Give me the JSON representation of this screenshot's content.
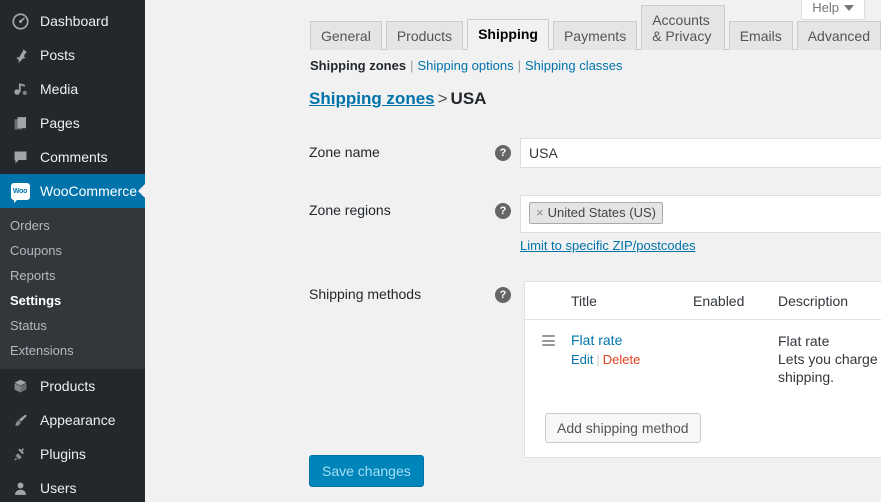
{
  "sidebar": {
    "items": [
      {
        "label": "Dashboard",
        "icon": "dashboard-icon",
        "name": "dashboard"
      },
      {
        "label": "Posts",
        "icon": "pushpin-icon",
        "name": "posts"
      },
      {
        "label": "Media",
        "icon": "media-icon",
        "name": "media"
      },
      {
        "label": "Pages",
        "icon": "pages-icon",
        "name": "pages"
      },
      {
        "label": "Comments",
        "icon": "comment-icon",
        "name": "comments"
      },
      {
        "label": "WooCommerce",
        "icon": "woocommerce-icon",
        "name": "woocommerce",
        "current": true
      },
      {
        "label": "Products",
        "icon": "box-icon",
        "name": "products"
      },
      {
        "label": "Appearance",
        "icon": "paintbrush-icon",
        "name": "appearance"
      },
      {
        "label": "Plugins",
        "icon": "plug-icon",
        "name": "plugins"
      },
      {
        "label": "Users",
        "icon": "user-icon",
        "name": "users"
      }
    ],
    "woo_badge_text": "Woo",
    "submenu": [
      {
        "label": "Orders",
        "current": false
      },
      {
        "label": "Coupons",
        "current": false
      },
      {
        "label": "Reports",
        "current": false
      },
      {
        "label": "Settings",
        "current": true
      },
      {
        "label": "Status",
        "current": false
      },
      {
        "label": "Extensions",
        "current": false
      }
    ]
  },
  "help": {
    "label": "Help",
    "icon": "chevron-down-icon"
  },
  "tabs": [
    {
      "label": "General",
      "active": false
    },
    {
      "label": "Products",
      "active": false
    },
    {
      "label": "Shipping",
      "active": true
    },
    {
      "label": "Payments",
      "active": false
    },
    {
      "label": "Accounts & Privacy",
      "active": false
    },
    {
      "label": "Emails",
      "active": false
    },
    {
      "label": "Advanced",
      "active": false
    }
  ],
  "subnav": {
    "current": "Shipping zones",
    "links": [
      "Shipping options",
      "Shipping classes"
    ],
    "separator": "|"
  },
  "breadcrumb": {
    "root": "Shipping zones",
    "separator": ">",
    "current": "USA"
  },
  "form": {
    "zone_name": {
      "label": "Zone name",
      "value": "USA",
      "placeholder": "Zone name",
      "help": "?"
    },
    "zone_regions": {
      "label": "Zone regions",
      "chip": "United States (US)",
      "chip_remove": "×",
      "help": "?",
      "zip_link": "Limit to specific ZIP/postcodes"
    },
    "shipping_methods": {
      "label": "Shipping methods",
      "help": "?",
      "columns": [
        "Title",
        "Enabled",
        "Description"
      ],
      "rows": [
        {
          "title": "Flat rate",
          "edit": "Edit",
          "delete": "Delete",
          "actions_separator": "|",
          "enabled": true,
          "desc_title": "Flat rate",
          "desc_sub": "Lets you charge a fixed rate for shipping."
        }
      ],
      "add_button": "Add shipping method"
    }
  },
  "save_button": "Save changes",
  "colors": {
    "admin_bg": "#23282d",
    "submenu_bg": "#32373c",
    "accent_blue": "#0073aa",
    "link_blue": "#0073aa",
    "delete_red": "#e2401c",
    "toggle_purple": "#a46497",
    "primary_button": "#0085ba",
    "page_bg": "#f1f1f1"
  }
}
